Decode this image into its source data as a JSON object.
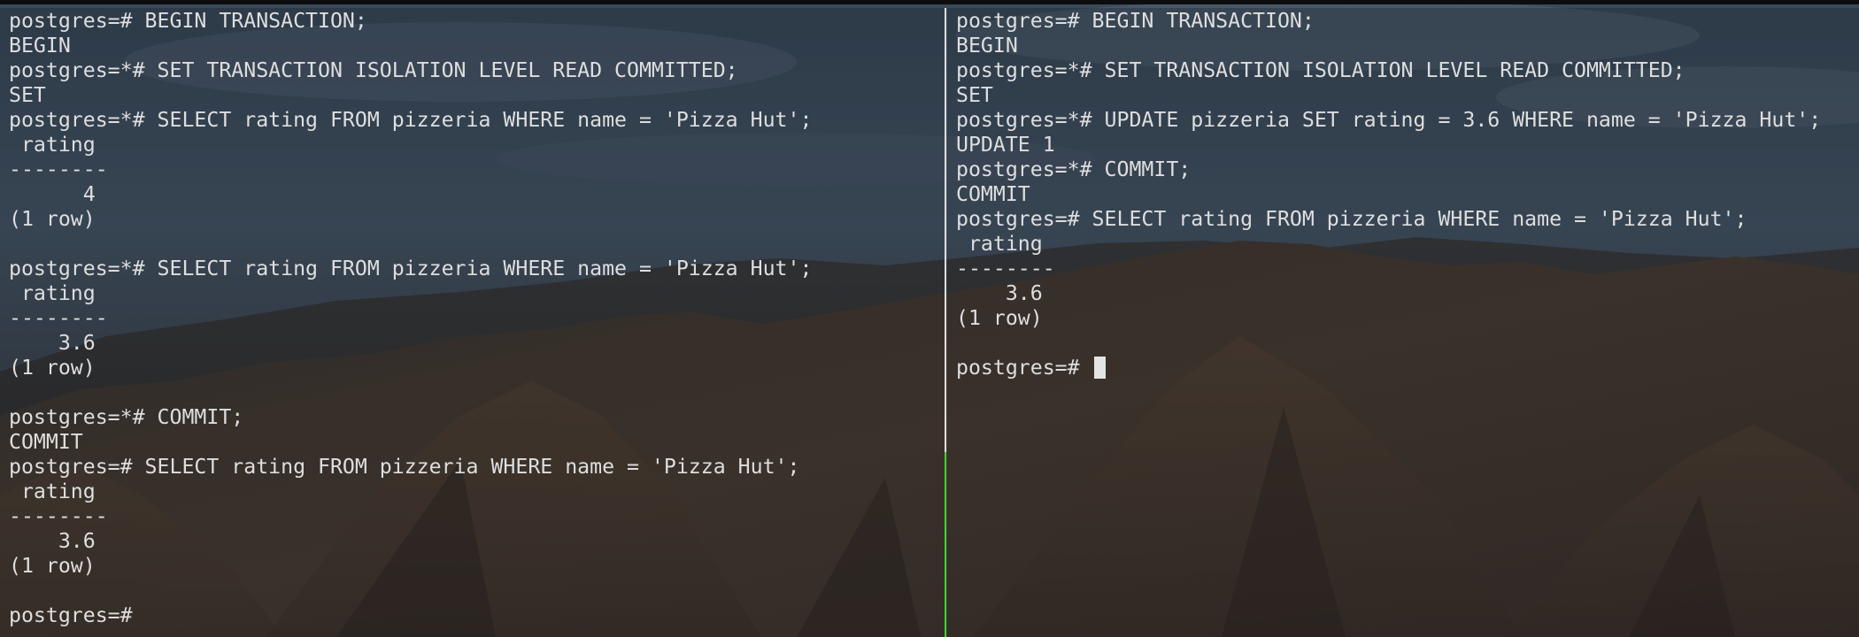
{
  "left_pane": {
    "lines": [
      "postgres=# BEGIN TRANSACTION;",
      "BEGIN",
      "postgres=*# SET TRANSACTION ISOLATION LEVEL READ COMMITTED;",
      "SET",
      "postgres=*# SELECT rating FROM pizzeria WHERE name = 'Pizza Hut';",
      " rating",
      "--------",
      "      4",
      "(1 row)",
      "",
      "postgres=*# SELECT rating FROM pizzeria WHERE name = 'Pizza Hut';",
      " rating",
      "--------",
      "    3.6",
      "(1 row)",
      "",
      "postgres=*# COMMIT;",
      "COMMIT",
      "postgres=# SELECT rating FROM pizzeria WHERE name = 'Pizza Hut';",
      " rating",
      "--------",
      "    3.6",
      "(1 row)",
      "",
      "postgres=# "
    ]
  },
  "right_pane": {
    "lines": [
      "postgres=# BEGIN TRANSACTION;",
      "BEGIN",
      "postgres=*# SET TRANSACTION ISOLATION LEVEL READ COMMITTED;",
      "SET",
      "postgres=*# UPDATE pizzeria SET rating = 3.6 WHERE name = 'Pizza Hut';",
      "UPDATE 1",
      "postgres=*# COMMIT;",
      "COMMIT",
      "postgres=# SELECT rating FROM pizzeria WHERE name = 'Pizza Hut';",
      " rating",
      "--------",
      "    3.6",
      "(1 row)",
      ""
    ],
    "prompt": "postgres=# "
  },
  "colors": {
    "text": "#dedede",
    "active_divider": "#3fd12f",
    "divider": "#dcdcdc",
    "cursor": "#e4e4e4"
  }
}
